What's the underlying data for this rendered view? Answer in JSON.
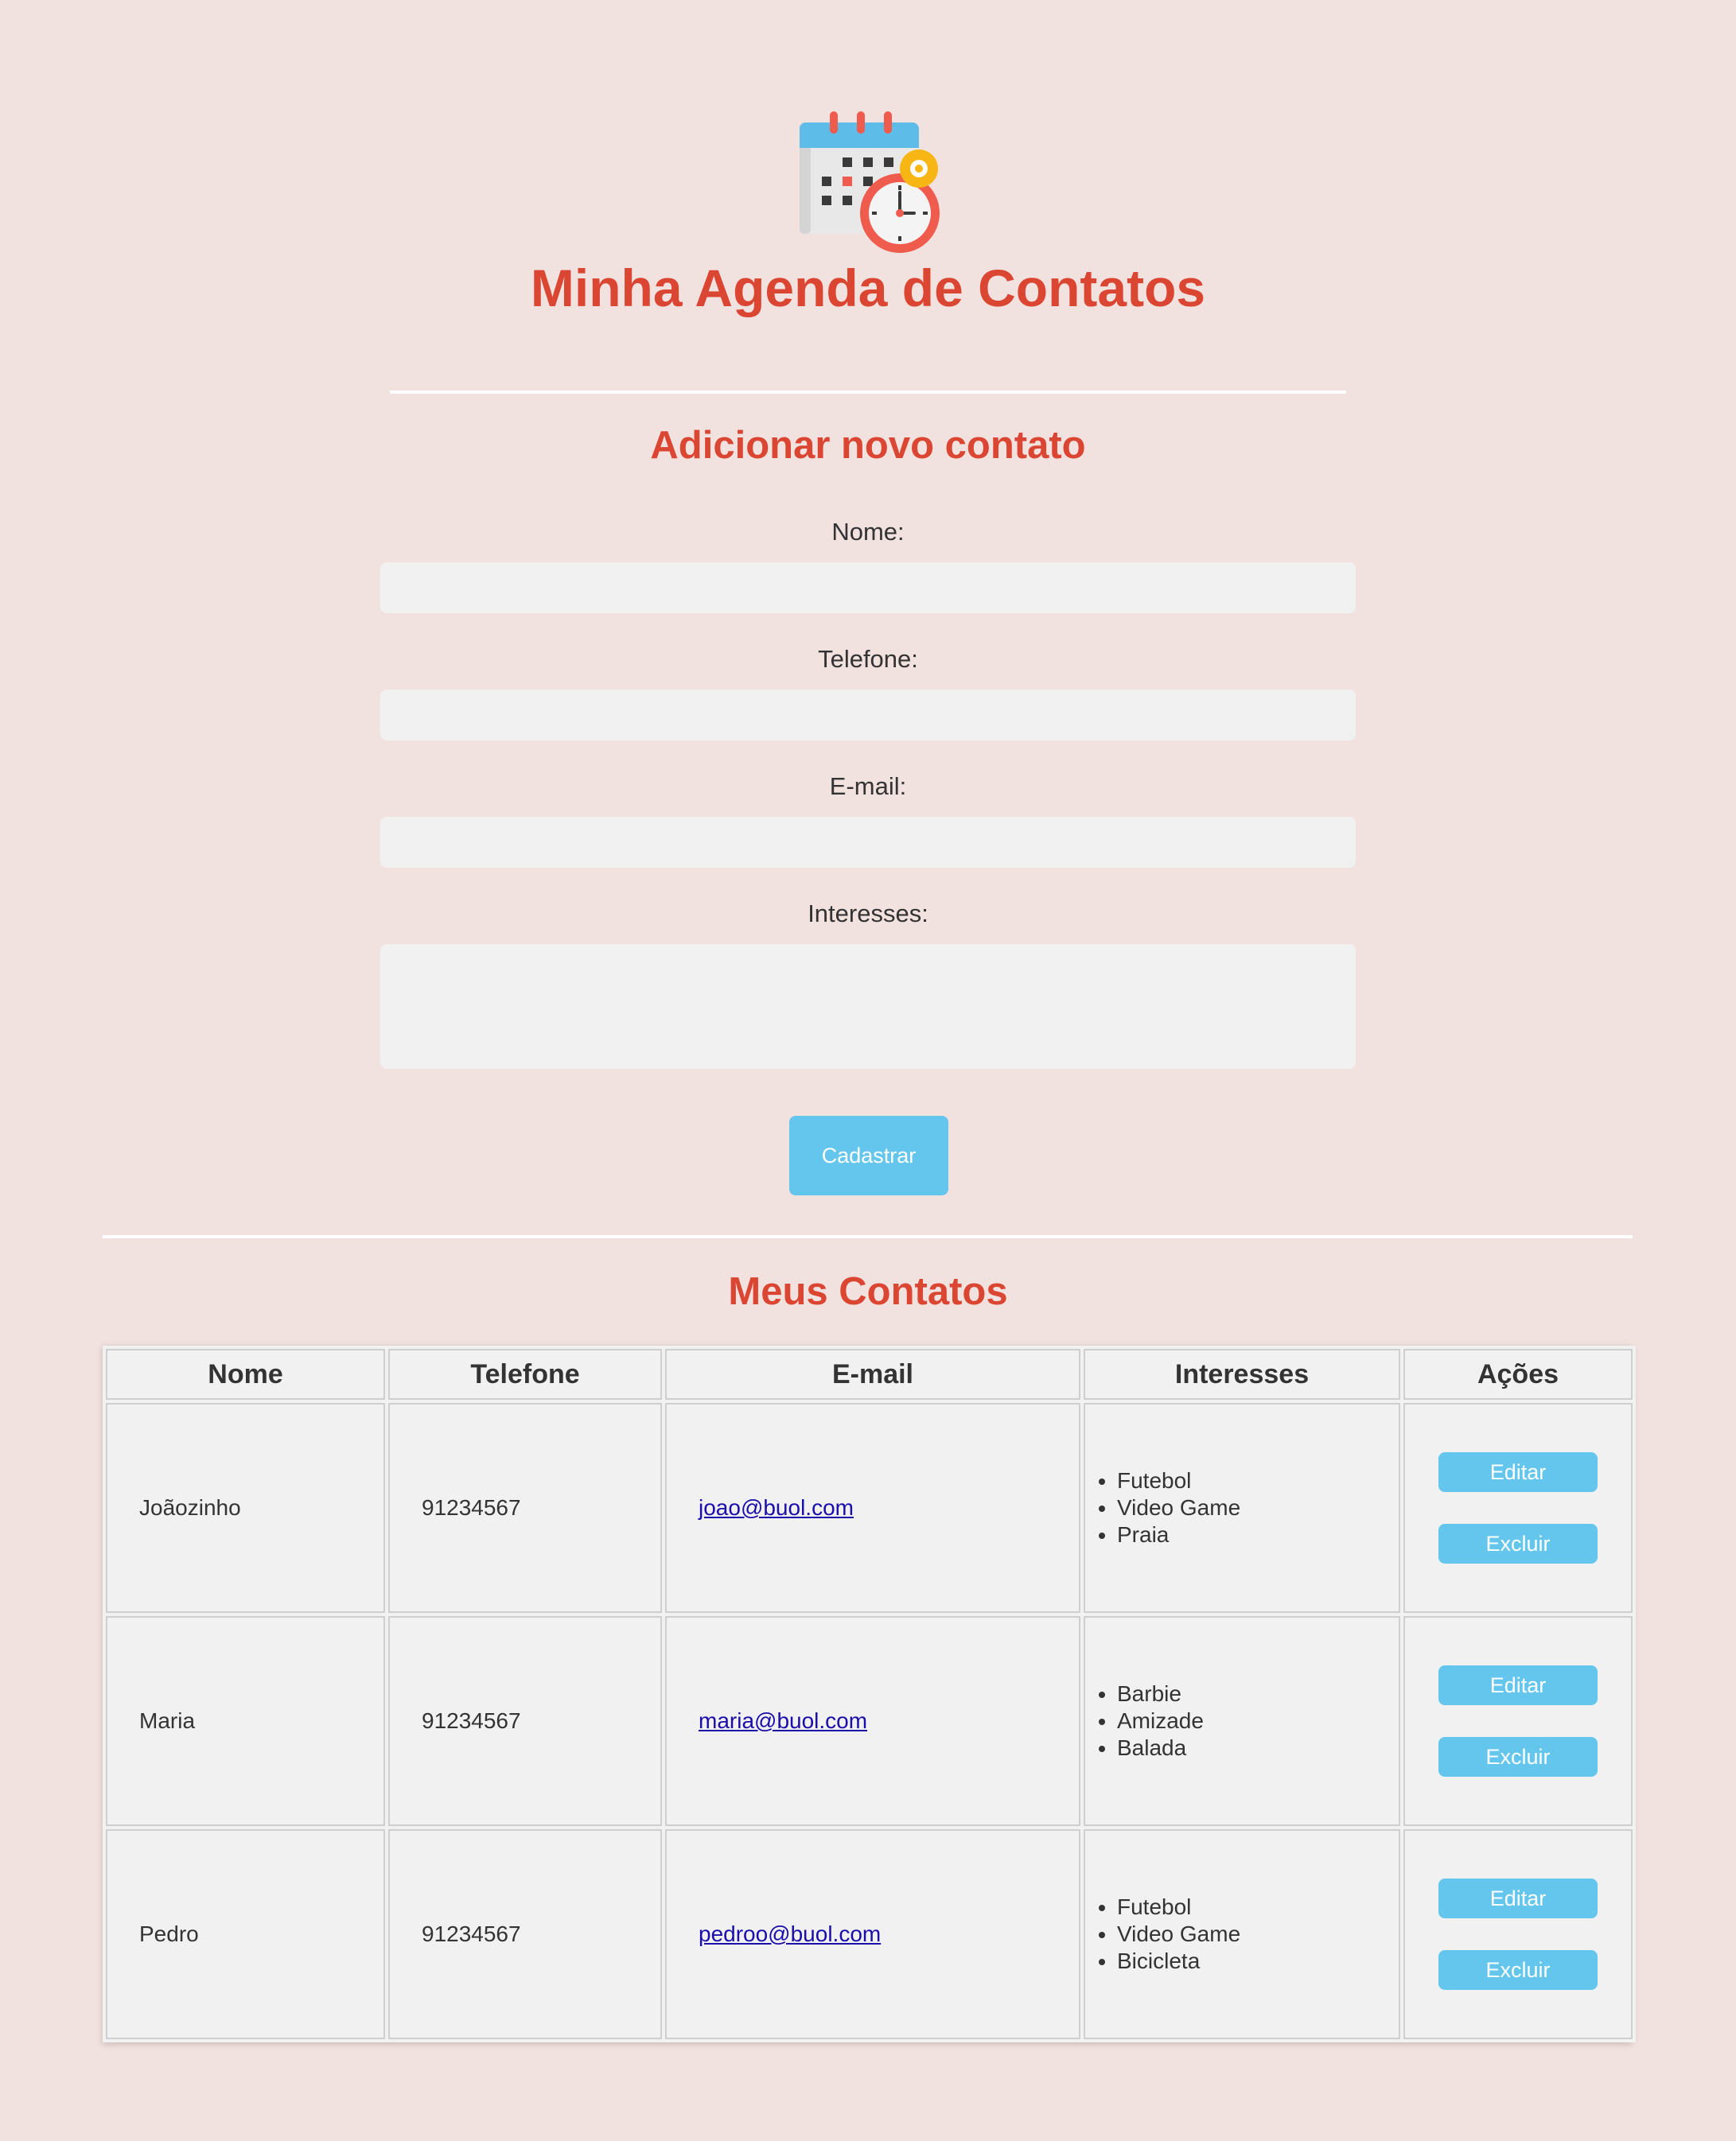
{
  "header": {
    "logo_icon": "calendar-clock-icon",
    "title": "Minha Agenda de Contatos"
  },
  "form": {
    "title": "Adicionar novo contato",
    "name_label": "Nome:",
    "name_value": "",
    "phone_label": "Telefone:",
    "phone_value": "",
    "email_label": "E-mail:",
    "email_value": "",
    "interests_label": "Interesses:",
    "interests_value": "",
    "submit_label": "Cadastrar"
  },
  "list": {
    "title": "Meus Contatos",
    "columns": [
      "Nome",
      "Telefone",
      "E-mail",
      "Interesses",
      "Ações"
    ],
    "rows": [
      {
        "name": "Joãozinho",
        "phone": "91234567",
        "email": "joao@buol.com",
        "interests": [
          "Futebol",
          "Video Game",
          "Praia"
        ],
        "edit_label": "Editar",
        "delete_label": "Excluir"
      },
      {
        "name": "Maria",
        "phone": "91234567",
        "email": "maria@buol.com",
        "interests": [
          "Barbie",
          "Amizade",
          "Balada"
        ],
        "edit_label": "Editar",
        "delete_label": "Excluir"
      },
      {
        "name": "Pedro",
        "phone": "91234567",
        "email": "pedroo@buol.com",
        "interests": [
          "Futebol",
          "Video Game",
          "Bicicleta"
        ],
        "edit_label": "Editar",
        "delete_label": "Excluir"
      }
    ]
  },
  "colors": {
    "background": "#f1e1df",
    "accent_red": "#db4633",
    "button_blue": "#64c6ed",
    "field_bg": "#f1f1f1"
  }
}
